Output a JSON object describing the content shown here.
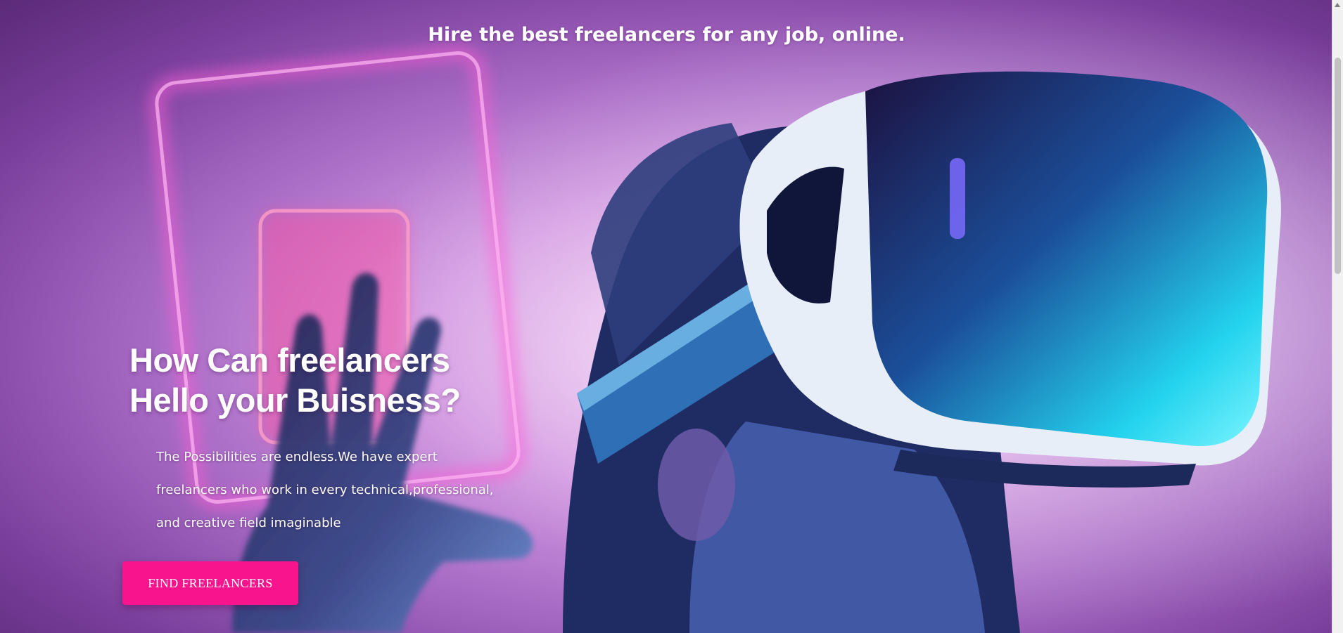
{
  "page": {
    "headline": "Hire the best freelancers for any job, online."
  },
  "hero": {
    "title_line1": "How Can freelancers",
    "title_line2": "Hello your Buisness?",
    "description": "The Possibilities are endless.We have expert freelancers who work in every technical,professional, and creative field imaginable",
    "cta_label": "FIND FREELANCERS",
    "image_subject": "person-wearing-vr-headset"
  },
  "colors": {
    "cta_background": "#f7148c",
    "neon_pink": "#ff5fd6",
    "headset_cyan": "#23d3ee"
  }
}
